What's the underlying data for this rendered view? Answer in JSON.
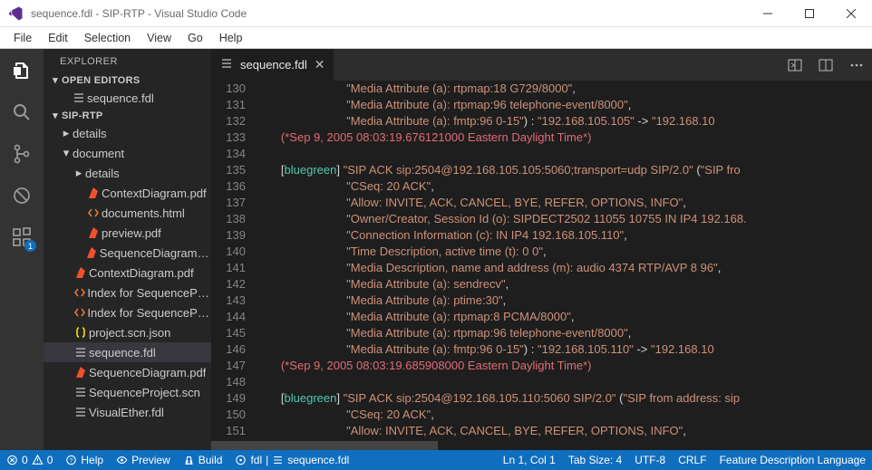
{
  "window": {
    "title": "sequence.fdl - SIP-RTP - Visual Studio Code"
  },
  "menu": {
    "items": [
      "File",
      "Edit",
      "Selection",
      "View",
      "Go",
      "Help"
    ]
  },
  "activity": {
    "badge": "1"
  },
  "explorer": {
    "title": "EXPLORER",
    "open_editors_hdr": "OPEN EDITORS",
    "open_editors": [
      {
        "label": "sequence.fdl",
        "icon": "default"
      }
    ],
    "workspace_hdr": "SIP-RTP",
    "tree": [
      {
        "depth": 0,
        "kind": "folder-closed",
        "label": "details"
      },
      {
        "depth": 0,
        "kind": "folder-open",
        "label": "document"
      },
      {
        "depth": 1,
        "kind": "folder-closed",
        "label": "details"
      },
      {
        "depth": 1,
        "kind": "file",
        "icon": "pdf",
        "label": "ContextDiagram.pdf"
      },
      {
        "depth": 1,
        "kind": "file",
        "icon": "html",
        "label": "documents.html"
      },
      {
        "depth": 1,
        "kind": "file",
        "icon": "pdf",
        "label": "preview.pdf"
      },
      {
        "depth": 1,
        "kind": "file",
        "icon": "pdf",
        "label": "SequenceDiagram.pdf"
      },
      {
        "depth": 0,
        "kind": "file",
        "icon": "pdf",
        "label": "ContextDiagram.pdf"
      },
      {
        "depth": 0,
        "kind": "file",
        "icon": "html",
        "label": "Index for SequencePro..."
      },
      {
        "depth": 0,
        "kind": "file",
        "icon": "html",
        "label": "Index for SequencePro..."
      },
      {
        "depth": 0,
        "kind": "file",
        "icon": "json",
        "label": "project.scn.json"
      },
      {
        "depth": 0,
        "kind": "file",
        "icon": "default",
        "label": "sequence.fdl",
        "selected": true
      },
      {
        "depth": 0,
        "kind": "file",
        "icon": "pdf",
        "label": "SequenceDiagram.pdf"
      },
      {
        "depth": 0,
        "kind": "file",
        "icon": "default",
        "label": "SequenceProject.scn"
      },
      {
        "depth": 0,
        "kind": "file",
        "icon": "default",
        "label": "VisualEther.fdl"
      }
    ]
  },
  "tabs": {
    "active": {
      "label": "sequence.fdl"
    }
  },
  "editor": {
    "lines": [
      {
        "n": 130,
        "indent": 28,
        "tokens": [
          {
            "t": "str",
            "v": "\"Media Attribute (a): rtpmap:18 G729/8000\""
          },
          {
            "t": "paren",
            "v": ","
          }
        ]
      },
      {
        "n": 131,
        "indent": 28,
        "tokens": [
          {
            "t": "str",
            "v": "\"Media Attribute (a): rtpmap:96 telephone-event/8000\""
          },
          {
            "t": "paren",
            "v": ","
          }
        ]
      },
      {
        "n": 132,
        "indent": 28,
        "tokens": [
          {
            "t": "str",
            "v": "\"Media Attribute (a): fmtp:96 0-15\""
          },
          {
            "t": "paren",
            "v": ") : "
          },
          {
            "t": "str",
            "v": "\"192.168.105.105\""
          },
          {
            "t": "paren",
            "v": " -> "
          },
          {
            "t": "str",
            "v": "\"192.168.10"
          }
        ]
      },
      {
        "n": 133,
        "indent": 8,
        "tokens": [
          {
            "t": "comment",
            "v": "(*Sep 9, 2005 08:03:19.676121000 Eastern Daylight Time*)"
          }
        ]
      },
      {
        "n": 134,
        "indent": 0,
        "tokens": []
      },
      {
        "n": 135,
        "indent": 8,
        "tokens": [
          {
            "t": "paren",
            "v": "["
          },
          {
            "t": "tag",
            "v": "bluegreen"
          },
          {
            "t": "paren",
            "v": "] "
          },
          {
            "t": "str",
            "v": "\"SIP ACK sip:2504@192.168.105.105:5060;transport=udp SIP/2.0\""
          },
          {
            "t": "paren",
            "v": " ("
          },
          {
            "t": "str",
            "v": "\"SIP fro"
          }
        ]
      },
      {
        "n": 136,
        "indent": 28,
        "tokens": [
          {
            "t": "str",
            "v": "\"CSeq: 20 ACK\""
          },
          {
            "t": "paren",
            "v": ","
          }
        ]
      },
      {
        "n": 137,
        "indent": 28,
        "tokens": [
          {
            "t": "str",
            "v": "\"Allow: INVITE, ACK, CANCEL, BYE, REFER, OPTIONS, INFO\""
          },
          {
            "t": "paren",
            "v": ","
          }
        ]
      },
      {
        "n": 138,
        "indent": 28,
        "tokens": [
          {
            "t": "str",
            "v": "\"Owner/Creator, Session Id (o): SIPDECT2502 11055 10755 IN IP4 192.168."
          }
        ]
      },
      {
        "n": 139,
        "indent": 28,
        "tokens": [
          {
            "t": "str",
            "v": "\"Connection Information (c): IN IP4 192.168.105.110\""
          },
          {
            "t": "paren",
            "v": ","
          }
        ]
      },
      {
        "n": 140,
        "indent": 28,
        "tokens": [
          {
            "t": "str",
            "v": "\"Time Description, active time (t): 0 0\""
          },
          {
            "t": "paren",
            "v": ","
          }
        ]
      },
      {
        "n": 141,
        "indent": 28,
        "tokens": [
          {
            "t": "str",
            "v": "\"Media Description, name and address (m): audio 4374 RTP/AVP 8 96\""
          },
          {
            "t": "paren",
            "v": ","
          }
        ]
      },
      {
        "n": 142,
        "indent": 28,
        "tokens": [
          {
            "t": "str",
            "v": "\"Media Attribute (a): sendrecv\""
          },
          {
            "t": "paren",
            "v": ","
          }
        ]
      },
      {
        "n": 143,
        "indent": 28,
        "tokens": [
          {
            "t": "str",
            "v": "\"Media Attribute (a): ptime:30\""
          },
          {
            "t": "paren",
            "v": ","
          }
        ]
      },
      {
        "n": 144,
        "indent": 28,
        "tokens": [
          {
            "t": "str",
            "v": "\"Media Attribute (a): rtpmap:8 PCMA/8000\""
          },
          {
            "t": "paren",
            "v": ","
          }
        ]
      },
      {
        "n": 145,
        "indent": 28,
        "tokens": [
          {
            "t": "str",
            "v": "\"Media Attribute (a): rtpmap:96 telephone-event/8000\""
          },
          {
            "t": "paren",
            "v": ","
          }
        ]
      },
      {
        "n": 146,
        "indent": 28,
        "tokens": [
          {
            "t": "str",
            "v": "\"Media Attribute (a): fmtp:96 0-15\""
          },
          {
            "t": "paren",
            "v": ") : "
          },
          {
            "t": "str",
            "v": "\"192.168.105.110\""
          },
          {
            "t": "paren",
            "v": " -> "
          },
          {
            "t": "str",
            "v": "\"192.168.10"
          }
        ]
      },
      {
        "n": 147,
        "indent": 8,
        "tokens": [
          {
            "t": "comment",
            "v": "(*Sep 9, 2005 08:03:19.685908000 Eastern Daylight Time*)"
          }
        ]
      },
      {
        "n": 148,
        "indent": 0,
        "tokens": []
      },
      {
        "n": 149,
        "indent": 8,
        "tokens": [
          {
            "t": "paren",
            "v": "["
          },
          {
            "t": "tag",
            "v": "bluegreen"
          },
          {
            "t": "paren",
            "v": "] "
          },
          {
            "t": "str",
            "v": "\"SIP ACK sip:2504@192.168.105.110:5060 SIP/2.0\""
          },
          {
            "t": "paren",
            "v": " ("
          },
          {
            "t": "str",
            "v": "\"SIP from address: sip"
          }
        ]
      },
      {
        "n": 150,
        "indent": 28,
        "tokens": [
          {
            "t": "str",
            "v": "\"CSeq: 20 ACK\""
          },
          {
            "t": "paren",
            "v": ","
          }
        ]
      },
      {
        "n": 151,
        "indent": 28,
        "tokens": [
          {
            "t": "str",
            "v": "\"Allow: INVITE, ACK, CANCEL, BYE, REFER, OPTIONS, INFO\""
          },
          {
            "t": "paren",
            "v": ","
          }
        ]
      }
    ]
  },
  "status": {
    "errors": "0",
    "warnings": "0",
    "help": "Help",
    "preview": "Preview",
    "build": "Build",
    "fdl": "fdl",
    "seq": "sequence.fdl",
    "pos": "Ln 1, Col 1",
    "tabsize": "Tab Size: 4",
    "encoding": "UTF-8",
    "eol": "CRLF",
    "lang": "Feature Description Language"
  }
}
